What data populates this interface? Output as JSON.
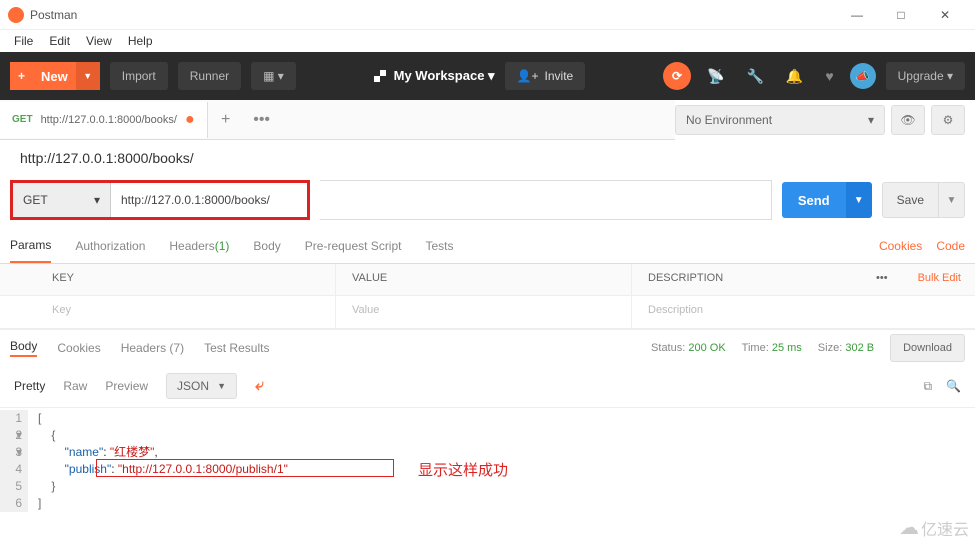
{
  "window": {
    "title": "Postman",
    "minimize": "—",
    "maximize": "□",
    "close": "✕"
  },
  "menu": {
    "file": "File",
    "edit": "Edit",
    "view": "View",
    "help": "Help"
  },
  "toolbar": {
    "new_label": "New",
    "import_label": "Import",
    "runner_label": "Runner",
    "workspace": "My Workspace ▾",
    "invite": "Invite",
    "upgrade": "Upgrade ▾",
    "plus": "+",
    "caret": "▼"
  },
  "tabs": {
    "method": "GET",
    "title": "http://127.0.0.1:8000/books/",
    "dot": "●",
    "add": "+",
    "more": "•••"
  },
  "env": {
    "selected": "No Environment",
    "caret": "▾"
  },
  "request": {
    "name": "http://127.0.0.1:8000/books/",
    "method": "GET",
    "method_caret": "▾",
    "url": "http://127.0.0.1:8000/books/",
    "send": "Send",
    "send_caret": "▼",
    "save": "Save",
    "save_caret": "▼"
  },
  "req_tabs": {
    "params": "Params",
    "auth": "Authorization",
    "headers": "Headers",
    "headers_count": "(1)",
    "body": "Body",
    "prereq": "Pre-request Script",
    "tests": "Tests",
    "cookies": "Cookies",
    "code": "Code"
  },
  "params_table": {
    "h_key": "KEY",
    "h_value": "VALUE",
    "h_desc": "DESCRIPTION",
    "bulk": "Bulk Edit",
    "more": "•••",
    "p_key": "Key",
    "p_value": "Value",
    "p_desc": "Description"
  },
  "resp_tabs": {
    "body": "Body",
    "cookies": "Cookies",
    "headers": "Headers",
    "headers_count": "(7)",
    "tests": "Test Results"
  },
  "resp_meta": {
    "status_label": "Status:",
    "status": "200 OK",
    "time_label": "Time:",
    "time": "25 ms",
    "size_label": "Size:",
    "size": "302 B",
    "download": "Download"
  },
  "resp_toolbar": {
    "pretty": "Pretty",
    "raw": "Raw",
    "preview": "Preview",
    "format": "JSON",
    "caret": "▼",
    "wrap": "⤶",
    "copy": "⧉",
    "search": "🔍"
  },
  "code": {
    "l1": "[",
    "l2": "    {",
    "l3_key": "\"name\"",
    "l3_colon": ": ",
    "l3_val": "\"红楼梦\"",
    "l3_comma": ",",
    "l4_key": "\"publish\"",
    "l4_colon": ": ",
    "l4_val": "\"http://127.0.0.1:8000/publish/1\"",
    "l5": "    }",
    "l6": "]",
    "gutter": [
      "1 ▾",
      "2 ▾",
      "3",
      "4",
      "5",
      "6"
    ]
  },
  "annotation": "显示这样成功",
  "watermark": "亿速云"
}
